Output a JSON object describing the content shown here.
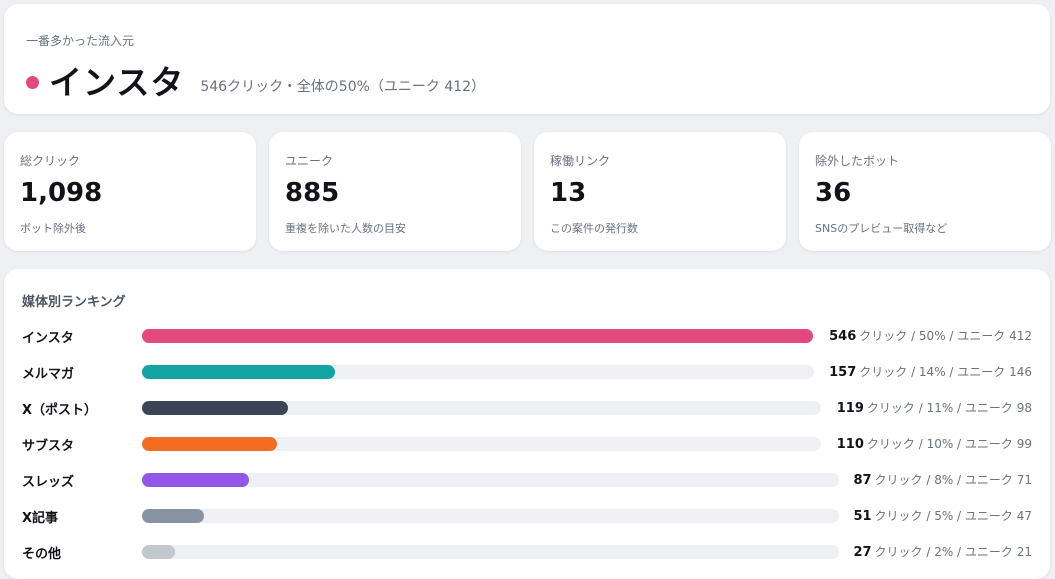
{
  "hero": {
    "label": "一番多かった流入元",
    "title": "インスタ",
    "subtitle": "546クリック・全体の50%（ユニーク 412）",
    "dot_color": "#e24a7f"
  },
  "stats": [
    {
      "label": "総クリック",
      "value": "1,098",
      "note": "ボット除外後"
    },
    {
      "label": "ユニーク",
      "value": "885",
      "note": "重複を除いた人数の目安"
    },
    {
      "label": "稼働リンク",
      "value": "13",
      "note": "この案件の発行数"
    },
    {
      "label": "除外したボット",
      "value": "36",
      "note": "SNSのプレビュー取得など"
    }
  ],
  "ranking": {
    "title": "媒体別ランキング",
    "items": [
      {
        "name": "インスタ",
        "clicks": "546",
        "detail": "クリック / 50% / ユニーク 412",
        "share": 1.0,
        "color": "#e24a7f"
      },
      {
        "name": "メルマガ",
        "clicks": "157",
        "detail": "クリック / 14% / ユニーク 146",
        "share": 0.287,
        "color": "#14a3a3"
      },
      {
        "name": "X（ポスト）",
        "clicks": "119",
        "detail": "クリック / 11% / ユニーク 98",
        "share": 0.218,
        "color": "#3b4556"
      },
      {
        "name": "サブスタ",
        "clicks": "110",
        "detail": "クリック / 10% / ユニーク 99",
        "share": 0.201,
        "color": "#f26d21"
      },
      {
        "name": "スレッズ",
        "clicks": "87",
        "detail": "クリック / 8% / ユニーク 71",
        "share": 0.159,
        "color": "#9257e8"
      },
      {
        "name": "X記事",
        "clicks": "51",
        "detail": "クリック / 5% / ユニーク 47",
        "share": 0.093,
        "color": "#8893a4"
      },
      {
        "name": "その他",
        "clicks": "27",
        "detail": "クリック / 2% / ユニーク 21",
        "share": 0.049,
        "color": "#c3c7ce"
      }
    ]
  }
}
